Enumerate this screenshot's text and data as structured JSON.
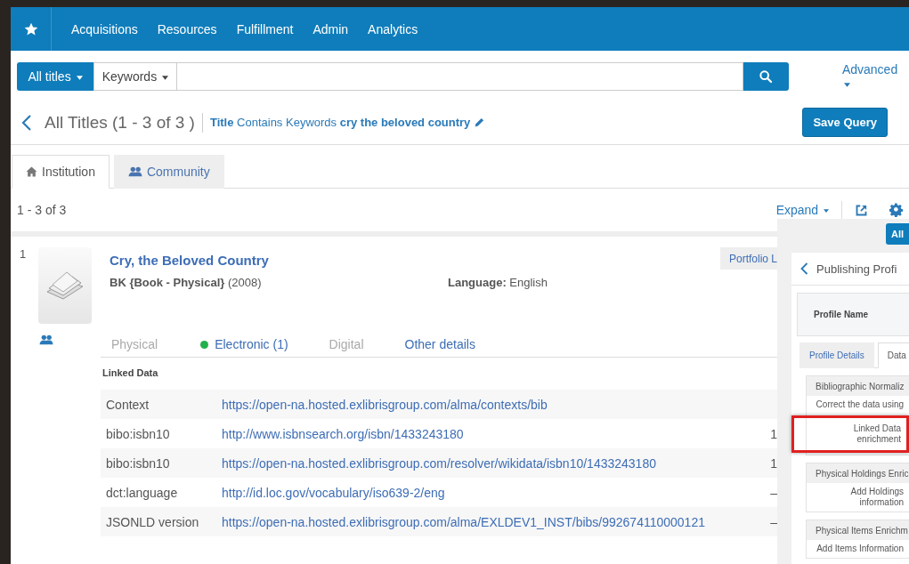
{
  "nav": {
    "items": [
      "Acquisitions",
      "Resources",
      "Fulfillment",
      "Admin",
      "Analytics"
    ]
  },
  "search": {
    "scope": "All titles",
    "field": "Keywords",
    "advanced": "Advanced"
  },
  "results_header": {
    "title": "All Titles (1 - 3 of 3 )",
    "query": "**Title** Contains Keywords **cry the beloved country**",
    "save_button": "Save Query"
  },
  "tabs": [
    {
      "label": "Institution",
      "selected": true
    },
    {
      "label": "Community",
      "selected": false
    }
  ],
  "count": "1 - 3 of 3",
  "toolbar": {
    "expand": "Expand"
  },
  "record": {
    "number": "1",
    "title": "Cry, the Beloved Country",
    "type": "BK {Book - Physical}",
    "year": "(2008)",
    "language_label": "Language:",
    "language": "English",
    "portfolio_button": "Portfolio L",
    "detail_tabs": [
      {
        "label": "Physical",
        "disabled": true,
        "dot": false
      },
      {
        "label": "Electronic (1)",
        "disabled": false,
        "dot": true
      },
      {
        "label": "Digital",
        "disabled": true,
        "dot": false
      },
      {
        "label": "Other details",
        "disabled": false,
        "dot": false
      }
    ],
    "linked_data": {
      "heading": "Linked Data",
      "rows": [
        {
          "property": "Context",
          "value": "https://open-na.hosted.exlibrisgroup.com/alma/contexts/bib"
        },
        {
          "property": "bibo:isbn10",
          "value": "http://www.isbnsearch.org/isbn/1433243180",
          "column_3": "1"
        },
        {
          "property": "bibo:isbn10",
          "value": "https://open-na.hosted.exlibrisgroup.com/resolver/wikidata/isbn10/1433243180",
          "column_3": "1"
        },
        {
          "property": "dct:language",
          "value": "http://id.loc.gov/vocabulary/iso639-2/eng",
          "column_3": "–"
        },
        {
          "property": "JSONLD version",
          "value": "https://open-na.hosted.exlibrisgroup.com/alma/EXLDEV1_INST/bibs/992674110000121",
          "column_3": "–"
        }
      ]
    }
  },
  "panel": {
    "all_button": "All",
    "title": "Publishing Profi",
    "profile_name_label": "Profile Name",
    "tabs": [
      {
        "label": "Profile Details",
        "selected": false
      },
      {
        "label": "Data",
        "selected": true
      }
    ],
    "sections": [
      {
        "heading": "Bibliographic Normaliz",
        "items": [
          {
            "text": "Correct the data using",
            "highlighted": false
          },
          {
            "text": "Linked Data enrichment",
            "highlighted": true
          }
        ]
      },
      {
        "heading": "Physical Holdings Enric",
        "items": [
          {
            "text": "Add Holdings information",
            "highlighted": false
          }
        ]
      },
      {
        "heading": "Physical Items Enrichm",
        "items": [
          {
            "text": "Add Items Information",
            "highlighted": false
          }
        ]
      }
    ]
  }
}
